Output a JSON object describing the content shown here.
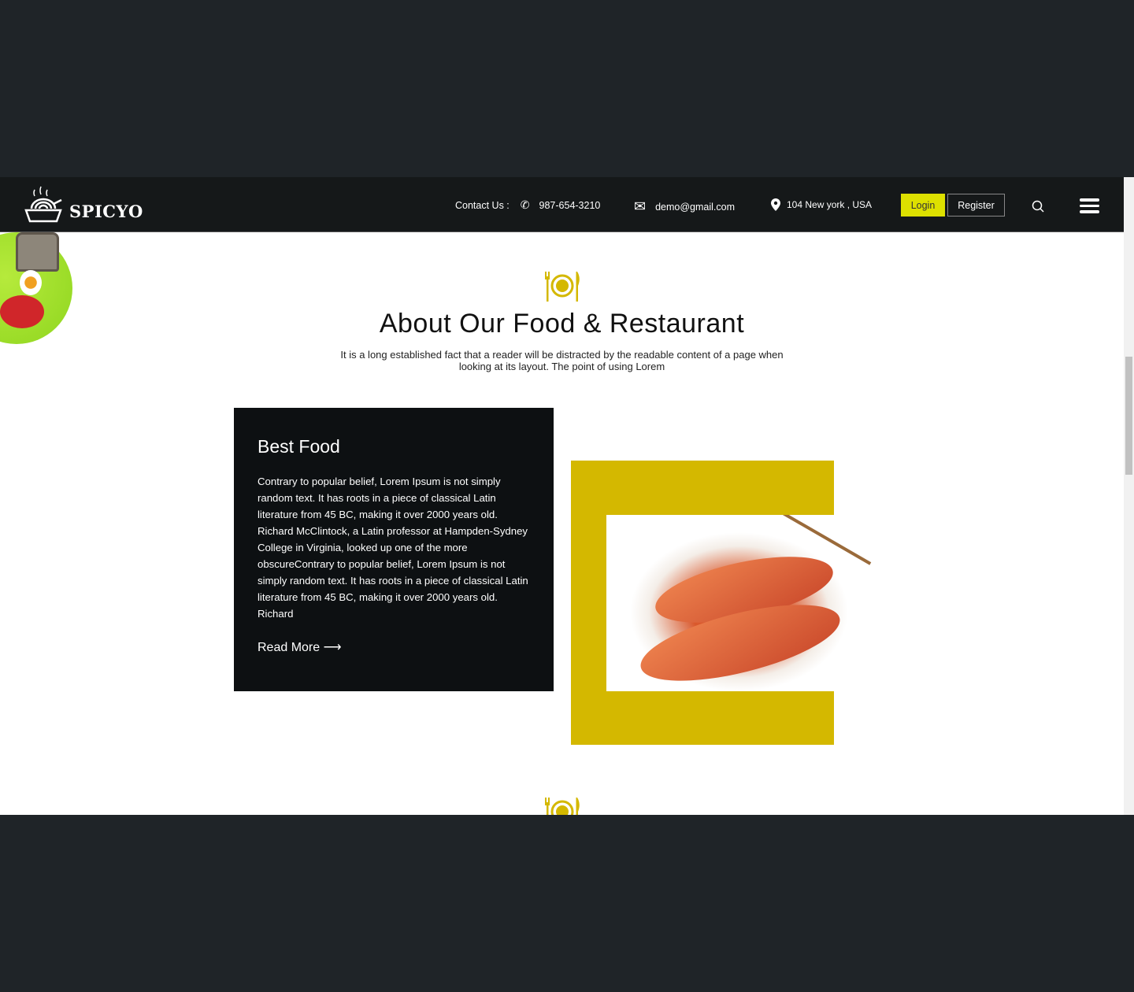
{
  "header": {
    "logo_text": "SPICYO",
    "contact_label": "Contact Us :",
    "phone": "987-654-3210",
    "email": "demo@gmail.com",
    "address": "104 New york , USA",
    "login": "Login",
    "register": "Register"
  },
  "about": {
    "title": "About Our Food & Restaurant",
    "subtitle": "It is a long established fact that a reader will be distracted by the readable content of a page when looking at its layout. The point of using Lorem"
  },
  "card": {
    "title": "Best Food",
    "body": "Contrary to popular belief, Lorem Ipsum is not simply random text. It has roots in a piece of classical Latin literature from 45 BC, making it over 2000 years old. Richard McClintock, a Latin professor at Hampden-Sydney College in Virginia, looked up one of the more obscureContrary to popular belief, Lorem Ipsum is not simply random text. It has roots in a piece of classical Latin literature from 45 BC, making it over 2000 years old. Richard",
    "read_more": "Read More ⟶"
  },
  "colors": {
    "accent": "#d4b800",
    "login": "#dde000",
    "header": "#151819",
    "card": "#0d1012"
  }
}
